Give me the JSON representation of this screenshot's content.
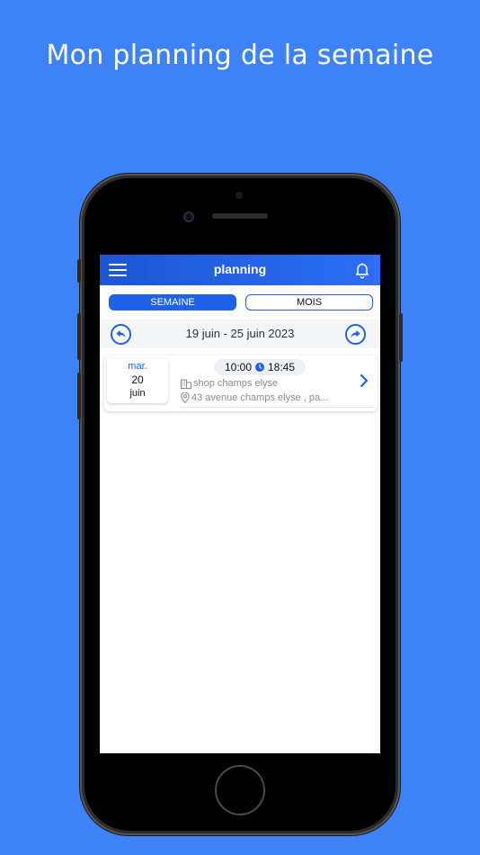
{
  "headline": "Mon planning de la semaine",
  "appbar": {
    "title": "planning",
    "menu_icon": "hamburger-menu-icon",
    "bell_icon": "bell-icon"
  },
  "segments": {
    "week_label": "SEMAINE",
    "month_label": "MOIS",
    "selected": "SEMAINE"
  },
  "week": {
    "range": "19 juin - 25 juin 2023",
    "prev_icon": "back-arrow-icon",
    "next_icon": "forward-arrow-icon"
  },
  "shifts": [
    {
      "weekday": "mar.",
      "day": "20",
      "month": "juin",
      "start": "10:00",
      "end": "18:45",
      "shop": "shop champs elyse",
      "address": "43 avenue champs elyse , pa..."
    }
  ],
  "colors": {
    "background": "#3d82f7",
    "accent": "#1f62e8",
    "appbar_start": "#1a56d6",
    "appbar_end": "#2d6ef5"
  }
}
